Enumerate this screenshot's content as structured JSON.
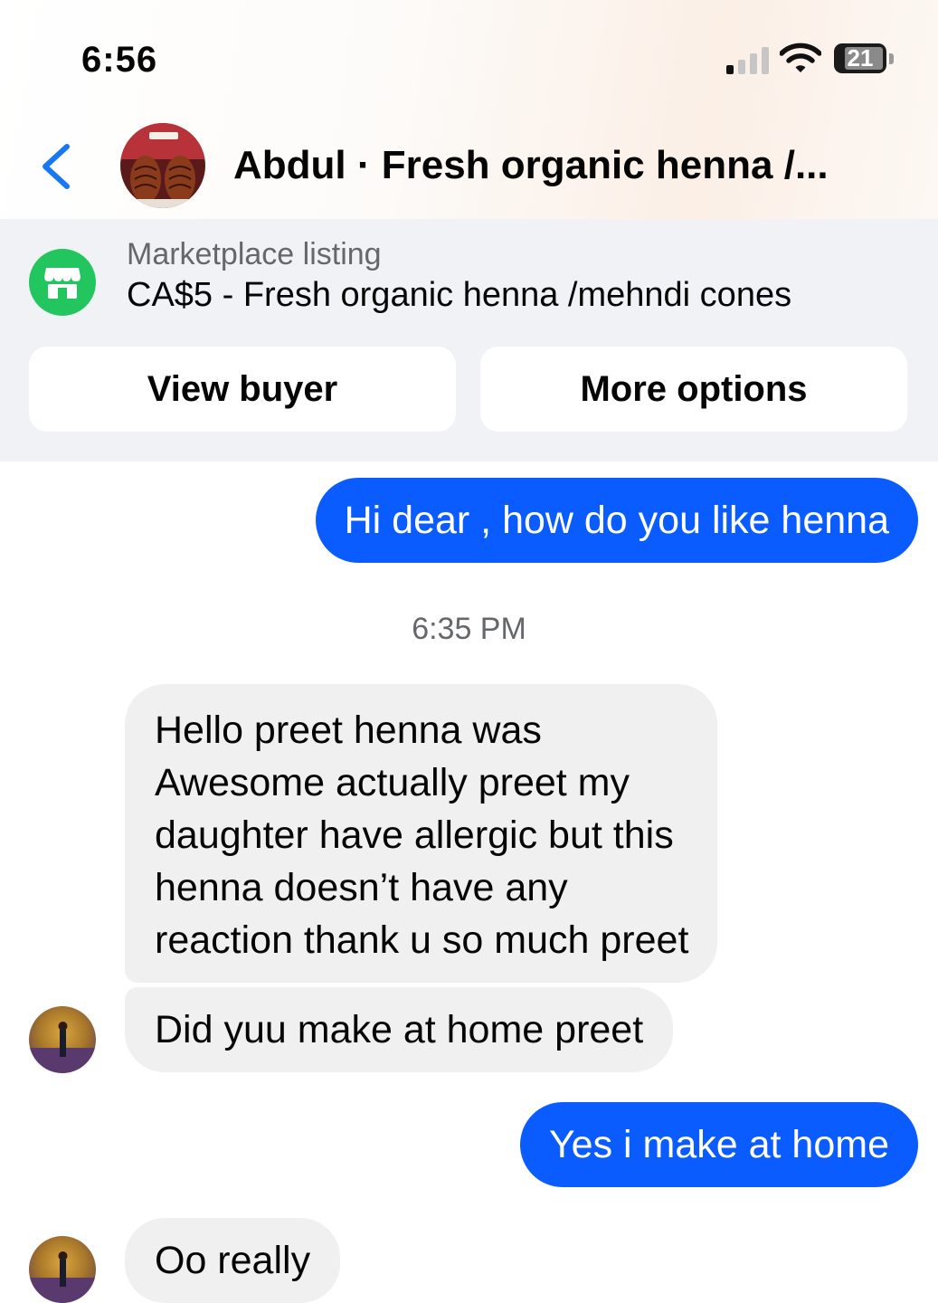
{
  "status_bar": {
    "time": "6:56",
    "battery": "21",
    "signal_bars_active": 1,
    "signal_bars_total": 4
  },
  "header": {
    "title": "Abdul · Fresh organic henna /..."
  },
  "listing": {
    "label": "Marketplace listing",
    "price_title": "CA$5 - Fresh organic henna /mehndi cones",
    "buttons": {
      "view_buyer": "View buyer",
      "more_options": "More options"
    }
  },
  "messages": [
    {
      "from": "me",
      "text": "Hi dear , how do you like henna"
    },
    {
      "type": "timestamp",
      "text": "6:35 PM"
    },
    {
      "from": "them",
      "lines": [
        "Hello preet henna was",
        "Awesome actually preet my",
        "daughter have allergic but this",
        "henna doesn’t have any",
        "reaction thank u so much preet"
      ]
    },
    {
      "from": "them",
      "text": "Did yuu make at home preet"
    },
    {
      "from": "me",
      "text": "Yes i make at home"
    },
    {
      "from": "them",
      "text": "Oo really"
    }
  ],
  "colors": {
    "outgoing_bubble": "#0a5cff",
    "incoming_bubble": "#f0f0f0",
    "marketplace_icon": "#22c55e",
    "back_arrow": "#1877f2"
  }
}
